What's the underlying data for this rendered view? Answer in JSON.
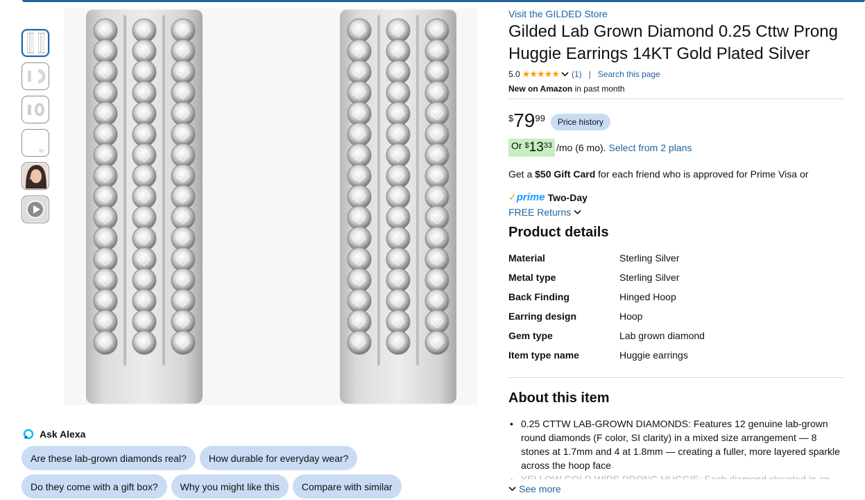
{
  "thumbnails": [
    {
      "icon": "earring-front-thumb"
    },
    {
      "icon": "earring-side-thumb"
    },
    {
      "icon": "earring-pair-thumb"
    },
    {
      "icon": "earring-box-thumb"
    },
    {
      "icon": "model-photo-thumb"
    },
    {
      "icon": "video-play-thumb"
    }
  ],
  "store_link": "Visit the GILDED Store",
  "product_title": "Gilded Lab Grown Diamond 0.25 Cttw Prong Huggie Earrings 14KT Gold Plated Silver",
  "rating": {
    "value": "5.0",
    "stars": "★★★★★",
    "count": "(1)",
    "separator": "|",
    "search_page": "Search this page"
  },
  "new_on_amazon": {
    "bold": "New on Amazon",
    "rest": " in past month"
  },
  "price": {
    "symbol": "$",
    "whole": "79",
    "fraction": "99",
    "history_label": "Price history"
  },
  "monthly": {
    "prefix": "Or ",
    "symbol": "$",
    "whole": "13",
    "fraction": "33",
    "suffix": "/mo (6 mo).",
    "plans_link": "Select from 2 plans"
  },
  "gift_card": {
    "prefix": "Get a ",
    "bold": "$50 Gift Card",
    "rest": " for each friend who is approved for Prime Visa or"
  },
  "prime": {
    "check": "✓",
    "word": "prime",
    "two_day": "Two-Day",
    "returns": "FREE Returns"
  },
  "product_details": {
    "heading": "Product details",
    "rows": [
      {
        "label": "Material",
        "value": "Sterling Silver"
      },
      {
        "label": "Metal type",
        "value": "Sterling Silver"
      },
      {
        "label": "Back Finding",
        "value": "Hinged Hoop"
      },
      {
        "label": "Earring design",
        "value": "Hoop"
      },
      {
        "label": "Gem type",
        "value": "Lab grown diamond"
      },
      {
        "label": "Item type name",
        "value": "Huggie earrings"
      }
    ]
  },
  "about": {
    "heading": "About this item",
    "bullets": [
      "0.25 CTTW LAB-GROWN DIAMONDS: Features 12 genuine lab-grown round diamonds (F color, SI clarity) in a mixed size arrangement — 8 stones at 1.7mm and 4 at 1.8mm — creating a fuller, more layered sparkle across the hoop face",
      "YELLOW GOLD WIRE PRONG HUGGIE: Each diamond elevated in an open"
    ],
    "see_more": "See more"
  },
  "ask_alexa": {
    "title": "Ask Alexa",
    "chips_row1": [
      "Are these lab-grown diamonds real?",
      "How durable for everyday wear?"
    ],
    "chips_row2": [
      "Do they come with a gift box?",
      "Why you might like this",
      "Compare with similar"
    ]
  },
  "colors": {
    "link": "#2162a1",
    "chip_bg": "#c9dcf4",
    "monthly_bg": "#c6eec0",
    "star": "#ff9900",
    "prime_blue": "#1a98ff"
  }
}
